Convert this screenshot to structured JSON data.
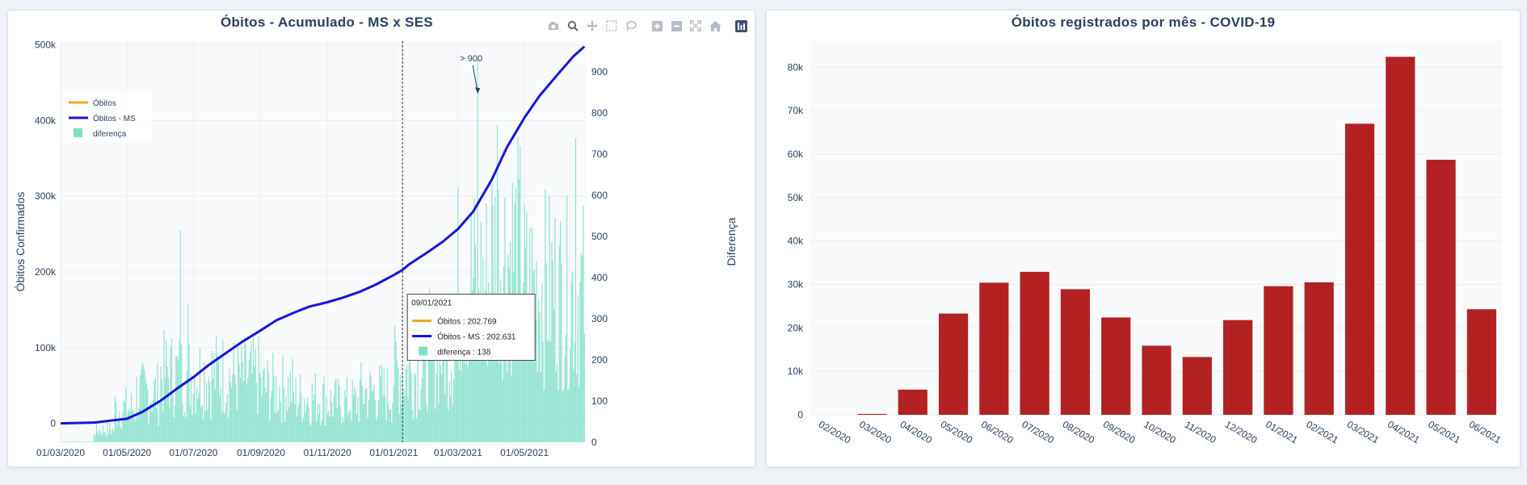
{
  "left_panel": {
    "title": "Óbitos - Acumulado - MS x SES",
    "modebar_icons": [
      "camera-icon",
      "zoom-icon",
      "pan-icon",
      "box-select-icon",
      "lasso-icon",
      "zoom-in-icon",
      "zoom-out-icon",
      "autoscale-icon",
      "reset-axes-icon",
      "plotly-logo-icon"
    ]
  },
  "right_panel": {
    "title": "Óbitos registrados por mês - COVID-19"
  },
  "colors": {
    "obitos": "#f5a623",
    "obitos_ms": "#1515d6",
    "diferenca": "#7fe0c9",
    "monthly_bar": "#b22222",
    "axis_text": "#2a3f5f",
    "grid": "#ffffff",
    "plot_bg": "#f9fafb"
  },
  "chart_data": [
    {
      "type": "line",
      "title": "Óbitos - Acumulado - MS x SES",
      "ylabel": "Óbitos Confirmados",
      "y2label": "Diferença",
      "ylim": [
        -25000,
        505000
      ],
      "y2lim": [
        0,
        975
      ],
      "xlim": [
        "2020-03-01",
        "2021-06-27"
      ],
      "x_tick_labels": [
        "01/03/2020",
        "01/05/2020",
        "01/07/2020",
        "01/09/2020",
        "01/11/2020",
        "01/01/2021",
        "01/03/2021",
        "01/05/2021"
      ],
      "y_tick_labels": [
        "0",
        "100k",
        "200k",
        "300k",
        "400k",
        "500k"
      ],
      "y2_tick_labels": [
        "0",
        "100",
        "200",
        "300",
        "400",
        "500",
        "600",
        "700",
        "800",
        "900"
      ],
      "legend": {
        "position": "top-left",
        "entries": [
          "Óbitos",
          "Óbitos - MS",
          "diferença"
        ]
      },
      "series": [
        {
          "name": "Óbitos - MS",
          "axis": "y",
          "type": "line",
          "x": [
            "2020-03-01",
            "2020-04-01",
            "2020-05-01",
            "2020-05-15",
            "2020-06-01",
            "2020-06-15",
            "2020-07-01",
            "2020-07-15",
            "2020-08-01",
            "2020-08-15",
            "2020-09-01",
            "2020-09-15",
            "2020-10-01",
            "2020-10-15",
            "2020-11-01",
            "2020-11-15",
            "2020-12-01",
            "2020-12-15",
            "2021-01-01",
            "2021-01-09",
            "2021-01-15",
            "2021-02-01",
            "2021-02-15",
            "2021-03-01",
            "2021-03-15",
            "2021-04-01",
            "2021-04-15",
            "2021-05-01",
            "2021-05-15",
            "2021-06-01",
            "2021-06-15",
            "2021-06-25"
          ],
          "values": [
            0,
            1000,
            6000,
            15000,
            30000,
            45000,
            61000,
            77000,
            94000,
            108000,
            123000,
            136000,
            146000,
            154000,
            160000,
            166000,
            174000,
            183000,
            196000,
            202631,
            210000,
            226000,
            240000,
            257000,
            280000,
            322000,
            365000,
            404000,
            433000,
            462000,
            485000,
            498000
          ]
        },
        {
          "name": "Óbitos",
          "axis": "y",
          "type": "line",
          "x": [
            "2020-03-01",
            "2021-06-25"
          ],
          "values": [
            0,
            498000
          ]
        },
        {
          "name": "diferença",
          "axis": "y2",
          "type": "bar",
          "x_range": [
            "2020-03-01",
            "2021-06-25"
          ],
          "segments": [
            {
              "start": "2020-03-01",
              "end": "2020-04-01",
              "level": 2
            },
            {
              "start": "2020-04-01",
              "end": "2020-04-20",
              "level": 40
            },
            {
              "start": "2020-04-20",
              "end": "2020-05-10",
              "level": 110
            },
            {
              "start": "2020-05-10",
              "end": "2020-06-01",
              "level": 160
            },
            {
              "start": "2020-06-01",
              "end": "2020-07-01",
              "level": 220
            },
            {
              "start": "2020-07-01",
              "end": "2020-08-01",
              "level": 220
            },
            {
              "start": "2020-08-01",
              "end": "2020-09-01",
              "level": 210
            },
            {
              "start": "2020-09-01",
              "end": "2020-10-01",
              "level": 175
            },
            {
              "start": "2020-10-01",
              "end": "2020-11-01",
              "level": 145
            },
            {
              "start": "2020-11-01",
              "end": "2020-12-01",
              "level": 130
            },
            {
              "start": "2020-12-01",
              "end": "2021-01-01",
              "level": 160
            },
            {
              "start": "2021-01-01",
              "end": "2021-02-01",
              "level": 230
            },
            {
              "start": "2021-02-01",
              "end": "2021-03-01",
              "level": 300
            },
            {
              "start": "2021-03-01",
              "end": "2021-04-01",
              "level": 520
            },
            {
              "start": "2021-04-01",
              "end": "2021-05-01",
              "level": 610
            },
            {
              "start": "2021-05-01",
              "end": "2021-06-01",
              "level": 500
            },
            {
              "start": "2021-06-01",
              "end": "2021-06-25",
              "level": 480
            }
          ],
          "spikes": [
            {
              "x": "2020-06-19",
              "value": 516
            },
            {
              "x": "2020-06-26",
              "value": 335
            },
            {
              "x": "2021-03-19",
              "value": 930
            },
            {
              "x": "2021-04-06",
              "value": 770
            },
            {
              "x": "2021-06-17",
              "value": 740
            }
          ]
        }
      ],
      "annotation": {
        "text": "> 900",
        "x": "2021-03-19",
        "value": 900
      },
      "hover": {
        "x": "2021-01-09",
        "date_label": "09/01/2021",
        "rows": [
          {
            "label": "Óbitos : 202.769",
            "color_key": "obitos",
            "kind": "line"
          },
          {
            "label": "Óbitos - MS : 202.631",
            "color_key": "obitos_ms",
            "kind": "line"
          },
          {
            "label": "diferença : 138",
            "color_key": "diferenca",
            "kind": "square"
          }
        ]
      }
    },
    {
      "type": "bar",
      "title": "Óbitos registrados por mês - COVID-19",
      "categories": [
        "02/2020",
        "03/2020",
        "04/2020",
        "05/2020",
        "06/2020",
        "07/2020",
        "08/2020",
        "09/2020",
        "10/2020",
        "11/2020",
        "12/2020",
        "01/2021",
        "02/2021",
        "03/2021",
        "04/2021",
        "05/2021",
        "06/2021"
      ],
      "values": [
        0,
        200,
        5800,
        23300,
        30400,
        32900,
        28900,
        22400,
        15900,
        13300,
        21800,
        29600,
        30500,
        67000,
        82400,
        58700,
        24300
      ],
      "y_tick_labels": [
        "0",
        "10k",
        "20k",
        "30k",
        "40k",
        "50k",
        "60k",
        "70k",
        "80k"
      ],
      "ylim": [
        0,
        86000
      ]
    }
  ]
}
